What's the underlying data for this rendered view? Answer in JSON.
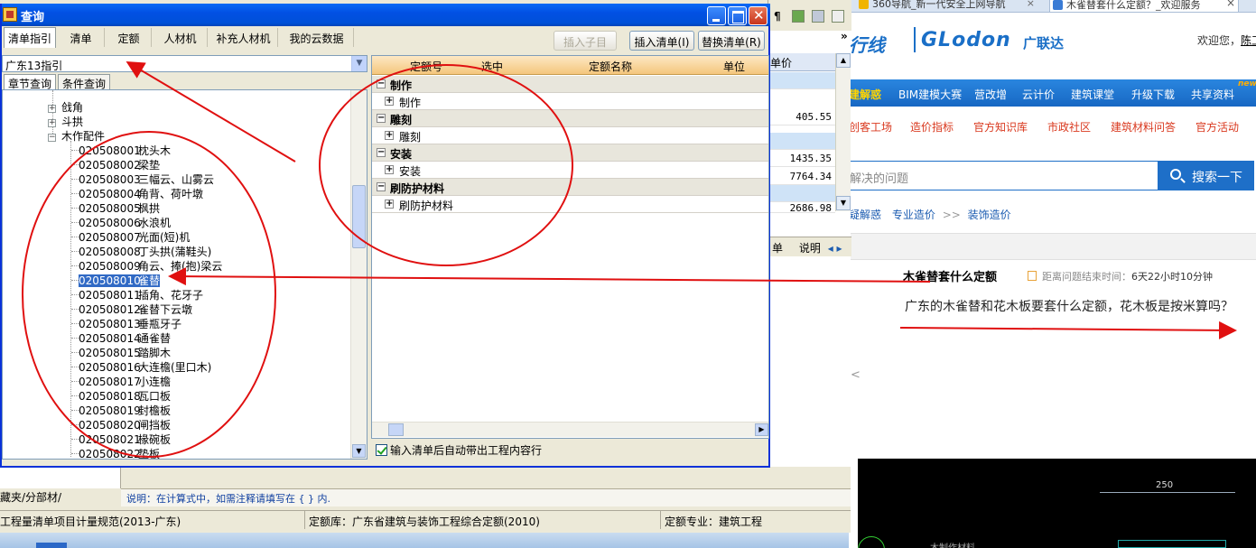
{
  "browser": {
    "tabs": [
      {
        "label": "360导航_新一代安全上网导航",
        "close": "×"
      },
      {
        "label": "木雀替套什么定额？_欢迎服务",
        "close": "×"
      }
    ],
    "logo": {
      "left": "行线",
      "main": "GLodon",
      "cn": "广联达"
    },
    "welcome": {
      "text": "欢迎您，",
      "user": "陈工"
    },
    "nav": [
      "建解惑",
      "BIM建模大赛",
      "营改增",
      "云计价",
      "建筑课堂",
      "升级下载",
      "共享资料"
    ],
    "nav_badge": "new",
    "subnav": [
      "创客工场",
      "造价指标",
      "官方知识库",
      "市政社区",
      "建筑材料问答",
      "官方活动"
    ],
    "search": {
      "placeholder": "解决的问题",
      "button": "搜索一下"
    },
    "breadcrumb": {
      "a": "疑解惑",
      "b": "专业造价",
      "sep": ">>",
      "c": "装饰造价"
    },
    "question": {
      "title": "木雀替套什么定额",
      "timer_label": "距离问题结束时间：",
      "timer_value": "6天22小时10分钟",
      "body": "广东的木雀替和花木板要套什么定额，花木板是按米算吗？"
    },
    "left_chevron": "<",
    "cad_dim": "250",
    "cad_text": "木制作材料"
  },
  "app": {
    "chevron": "»",
    "price_header": "单价",
    "prices": [
      "",
      "405.55",
      "",
      "1435.35",
      "7764.34",
      "",
      "2686.98"
    ],
    "tabs2": [
      "单",
      "说明"
    ],
    "sheet_tabs": "藏夹/分部材/",
    "note": "说明：在计算式中，如需注释请填写在 { } 内.",
    "status": [
      "工程量清单项目计量规范(2013-广东)",
      "定额库：广东省建筑与装饰工程综合定额(2010)",
      "定额专业：建筑工程"
    ]
  },
  "dialog": {
    "title": "查询",
    "tabs": [
      "清单指引",
      "清单",
      "定额",
      "人材机",
      "补充人材机",
      "我的云数据"
    ],
    "buttons": {
      "insert_child": "插入子目",
      "insert_list": "插入清单(I)",
      "replace_list": "替换清单(R)"
    },
    "combo_value": "广东13指引",
    "subtabs": [
      "章节查询",
      "条件查询"
    ],
    "tree_parents": [
      "戗角",
      "斗拱",
      "木作配件"
    ],
    "tree_items": [
      {
        "code": "020508001",
        "name": "枕头木"
      },
      {
        "code": "020508002",
        "name": "梁垫"
      },
      {
        "code": "020508003",
        "name": "三幅云、山雾云"
      },
      {
        "code": "020508004",
        "name": "角背、荷叶墩"
      },
      {
        "code": "020508005",
        "name": "枫拱"
      },
      {
        "code": "020508006",
        "name": "水浪机"
      },
      {
        "code": "020508007",
        "name": "光面(短)机"
      },
      {
        "code": "020508008",
        "name": "丁头拱(蒲鞋头)"
      },
      {
        "code": "020508009",
        "name": "角云、捧(抱)梁云"
      },
      {
        "code": "020508010",
        "name": "雀替"
      },
      {
        "code": "020508011",
        "name": "插角、花牙子"
      },
      {
        "code": "020508012",
        "name": "雀替下云墩"
      },
      {
        "code": "020508013",
        "name": "垂瓶牙子"
      },
      {
        "code": "020508014",
        "name": "通雀替"
      },
      {
        "code": "020508015",
        "name": "踏脚木"
      },
      {
        "code": "020508016",
        "name": "大连檐(里口木)"
      },
      {
        "code": "020508017",
        "name": "小连檐"
      },
      {
        "code": "020508018",
        "name": "瓦口板"
      },
      {
        "code": "020508019",
        "name": "封檐板"
      },
      {
        "code": "020508020",
        "name": "闸挡板"
      },
      {
        "code": "020508021",
        "name": "椽碗板"
      },
      {
        "code": "020508022",
        "name": "垫板"
      }
    ],
    "selected_code": "020508010",
    "grid_headers": [
      "定额号",
      "选中",
      "定额名称",
      "单位"
    ],
    "grid_groups": [
      {
        "group": "制作",
        "child": "制作"
      },
      {
        "group": "雕刻",
        "child": "雕刻"
      },
      {
        "group": "安装",
        "child": "安装"
      },
      {
        "group": "刷防护材料",
        "child": "刷防护材料"
      }
    ],
    "checkbox_label": "输入清单后自动带出工程内容行",
    "checkbox_checked": true
  },
  "colors": {
    "annotation": "#e01010",
    "title_bar": "#0a5fe6",
    "selection": "#316ac5",
    "nav": "#1c74d4"
  }
}
